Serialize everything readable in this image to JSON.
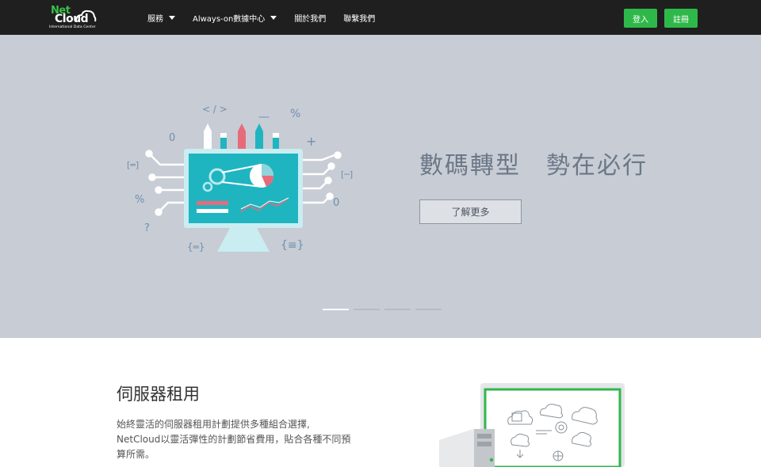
{
  "brand": {
    "name_top": "Net",
    "name_bottom": "Cloud",
    "tagline": "International Data Center"
  },
  "nav": {
    "items": [
      {
        "label": "服務",
        "has_dropdown": true
      },
      {
        "label": "Always-on數據中心",
        "has_dropdown": true
      },
      {
        "label": "關於我們",
        "has_dropdown": false
      },
      {
        "label": "聯繫我們",
        "has_dropdown": false
      }
    ],
    "login_label": "登入",
    "register_label": "註冊"
  },
  "hero": {
    "title": "數碼轉型　勢在必行",
    "cta_label": "了解更多",
    "slides_count": 4,
    "active_slide": 1,
    "art_symbols": {
      "code": "< / >",
      "dash": "—",
      "percent": "%",
      "zero": "0",
      "plus": "+",
      "bracket_left": "[═]",
      "bracket_right": "[─]",
      "question": "?",
      "brace_left": "{═}",
      "brace_right": "{≡}"
    }
  },
  "section": {
    "title": "伺服器租用",
    "description": "始終靈活的伺服器租用計劃提供多種組合選擇, NetCloud以靈活彈性的計劃節省費用，貼合各種不同預算所需。"
  },
  "colors": {
    "topbar": "#1f1f1f",
    "accent_green": "#2fb84a",
    "hero_bg": "#c8ccd4",
    "hero_text": "#6b7888",
    "monitor_teal": "#1fb5c0",
    "art_blue": "#6f8fb0"
  }
}
